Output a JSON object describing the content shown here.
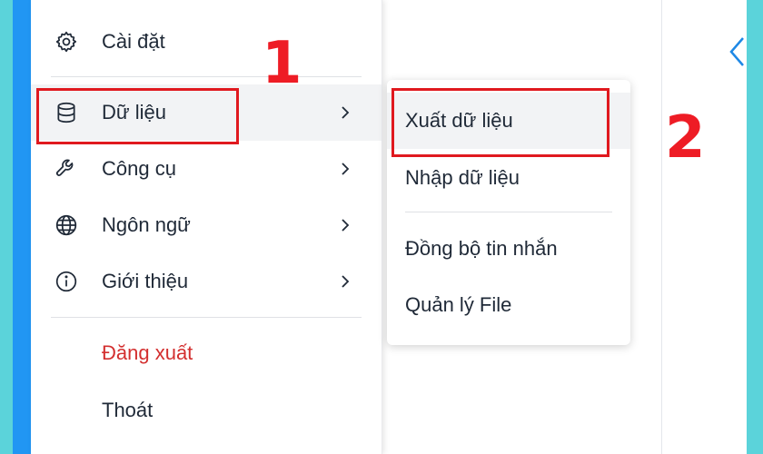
{
  "menu": {
    "items": [
      {
        "label": "Cài đặt",
        "icon": "gear-icon",
        "submenu": false
      },
      {
        "label": "Dữ liệu",
        "icon": "database-icon",
        "submenu": true
      },
      {
        "label": "Công cụ",
        "icon": "wrench-icon",
        "submenu": true
      },
      {
        "label": "Ngôn ngữ",
        "icon": "globe-icon",
        "submenu": true
      },
      {
        "label": "Giới thiệu",
        "icon": "info-icon",
        "submenu": true
      }
    ],
    "logout_label": "Đăng xuất",
    "quit_label": "Thoát"
  },
  "submenu": {
    "items": [
      "Xuất dữ liệu",
      "Nhập dữ liệu",
      "Đồng bộ tin nhắn",
      "Quản lý File"
    ]
  },
  "annotations": {
    "step1": "1",
    "step2": "2",
    "highlight_color": "#e0191f"
  },
  "colors": {
    "background": "#5bd3da",
    "accent_strip": "#2196f3",
    "danger_text": "#d32f2f"
  }
}
